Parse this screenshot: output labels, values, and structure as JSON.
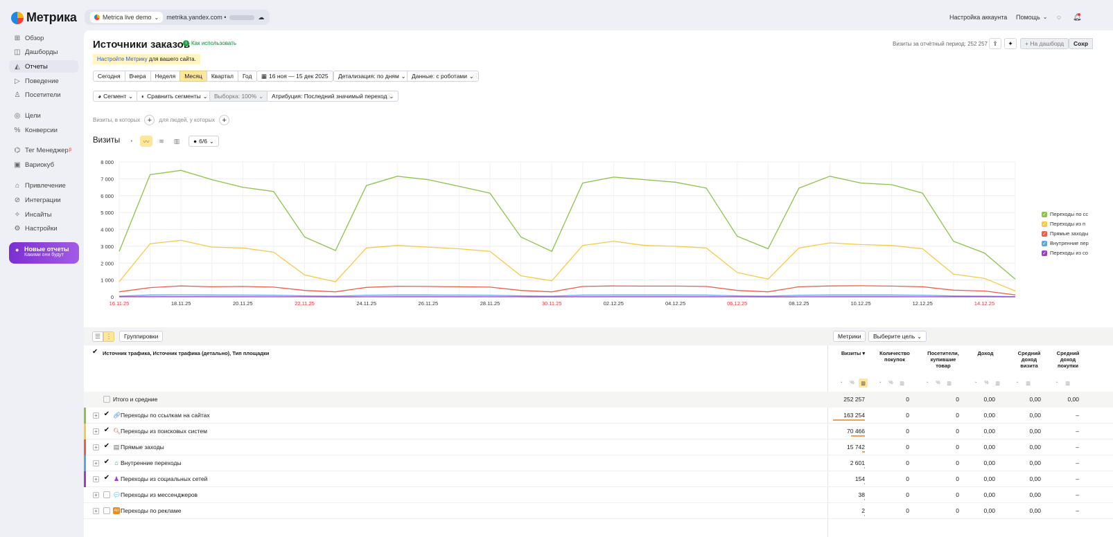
{
  "app": {
    "logo_text": "Метрика"
  },
  "counter": {
    "name": "Metrica live demo",
    "domain": "metrika.yandex.com •"
  },
  "topnav": {
    "account": "Настройка аккаунта",
    "help": "Помощь"
  },
  "sidebar": {
    "items": [
      {
        "label": "Обзор",
        "icon": "grid-icon"
      },
      {
        "label": "Дашборды",
        "icon": "dashboard-icon"
      },
      {
        "label": "Отчеты",
        "icon": "reports-icon"
      },
      {
        "label": "Поведение",
        "icon": "play-icon"
      },
      {
        "label": "Посетители",
        "icon": "user-icon"
      },
      {
        "label": "Цели",
        "icon": "target-icon"
      },
      {
        "label": "Конверсии",
        "icon": "percent-icon"
      },
      {
        "label": "Тег Менеджер",
        "icon": "tag-icon"
      },
      {
        "label": "Вариокуб",
        "icon": "cube-icon"
      },
      {
        "label": "Привлечение",
        "icon": "house-icon"
      },
      {
        "label": "Интеграции",
        "icon": "link-icon"
      },
      {
        "label": "Инсайты",
        "icon": "sparkle-icon"
      },
      {
        "label": "Настройки",
        "icon": "gear-icon"
      }
    ],
    "tag_badge": "β",
    "promo": {
      "title": "Новые отчеты",
      "subtitle": "Какими они будут"
    }
  },
  "page": {
    "title": "Источники заказов",
    "howto": "Как использовать",
    "banner_link": "Настройте Метрику",
    "banner_rest": " для вашего сайта.",
    "visits_period": "Визиты за отчётный период: 252 257",
    "dashboard_btn": "+ На дашборд",
    "save_btn": "Сохр"
  },
  "filters": {
    "periods": [
      "Сегодня",
      "Вчера",
      "Неделя",
      "Месяц",
      "Квартал",
      "Год"
    ],
    "active_period": "Месяц",
    "date_range": "16 ноя — 15 дек 2025",
    "detail": "Детализация: по дням",
    "data": "Данные: с роботами",
    "segment": "Сегмент",
    "compare": "Сравнить сегменты",
    "sample": "Выборка: 100%",
    "attribution": "Атрибуция: Последний значимый переход",
    "cond_left": "Визиты, в которых",
    "cond_right": "для людей, у которых"
  },
  "visits_block": {
    "title": "Визиты",
    "series_count": "6/6"
  },
  "chart_data": {
    "type": "line",
    "x": [
      "16.11.25",
      "17.11.25",
      "18.11.25",
      "19.11.25",
      "20.11.25",
      "21.11.25",
      "22.11.25",
      "23.11.25",
      "24.11.25",
      "25.11.25",
      "26.11.25",
      "27.11.25",
      "28.11.25",
      "29.11.25",
      "30.11.25",
      "01.12.25",
      "02.12.25",
      "03.12.25",
      "04.12.25",
      "05.12.25",
      "06.12.25",
      "07.12.25",
      "08.12.25",
      "09.12.25",
      "10.12.25",
      "11.12.25",
      "12.12.25",
      "13.12.25",
      "14.12.25",
      "15.12.25"
    ],
    "x_tick_labels": [
      "16.11.25",
      "18.11.25",
      "20.11.25",
      "22.11.25",
      "24.11.25",
      "26.11.25",
      "28.11.25",
      "30.11.25",
      "02.12.25",
      "04.12.25",
      "06.12.25",
      "08.12.25",
      "10.12.25",
      "12.12.25",
      "14.12.25"
    ],
    "weekend_ticks": [
      "16.11.25",
      "22.11.25",
      "30.11.25",
      "06.12.25",
      "14.12.25"
    ],
    "y_ticks": [
      "0",
      "1 000",
      "2 000",
      "3 000",
      "4 000",
      "5 000",
      "6 000",
      "7 000",
      "8 000"
    ],
    "ylim": [
      0,
      8000
    ],
    "grid": true,
    "legend_position": "right",
    "series": [
      {
        "name": "Переходы по сс",
        "color": "#8bc34a",
        "values": [
          2700,
          7250,
          7500,
          6950,
          6500,
          6250,
          3550,
          2750,
          6600,
          7150,
          6950,
          6550,
          6150,
          3550,
          2700,
          6750,
          7100,
          6950,
          6800,
          6450,
          3600,
          2850,
          6450,
          7150,
          6750,
          6650,
          6150,
          3300,
          2600,
          1050
        ]
      },
      {
        "name": "Переходы из п",
        "color": "#f8c945",
        "values": [
          900,
          3150,
          3350,
          2950,
          2900,
          2650,
          1300,
          900,
          2900,
          3050,
          2950,
          2850,
          2700,
          1250,
          950,
          3050,
          3300,
          3050,
          3000,
          2900,
          1450,
          1050,
          2900,
          3200,
          3100,
          3050,
          2850,
          1350,
          1100,
          350
        ]
      },
      {
        "name": "Прямые заходы",
        "color": "#f25c44",
        "values": [
          300,
          550,
          650,
          600,
          620,
          580,
          380,
          300,
          560,
          630,
          620,
          600,
          580,
          380,
          300,
          620,
          650,
          640,
          640,
          620,
          380,
          300,
          600,
          650,
          660,
          640,
          600,
          400,
          350,
          120
        ]
      },
      {
        "name": "Внутренние пер",
        "color": "#5aa7e0",
        "values": [
          40,
          110,
          120,
          110,
          105,
          100,
          60,
          40,
          100,
          110,
          110,
          105,
          100,
          60,
          40,
          105,
          110,
          110,
          110,
          105,
          60,
          40,
          100,
          110,
          110,
          110,
          100,
          55,
          45,
          15
        ]
      },
      {
        "name": "Переходы из со",
        "color": "#9c3fc4",
        "values": [
          5,
          8,
          8,
          7,
          7,
          6,
          3,
          2,
          6,
          7,
          7,
          7,
          6,
          3,
          2,
          7,
          8,
          7,
          7,
          7,
          3,
          2,
          6,
          8,
          7,
          7,
          6,
          3,
          3,
          1
        ]
      }
    ]
  },
  "table": {
    "groupings_btn": "Группировки",
    "metrics_btn": "Метрики",
    "goal_btn": "Выберите цель",
    "dimension_header": "Источник трафика, Источник трафика (детально), Тип площадки",
    "columns": [
      {
        "lines": [
          "Визиты ▾"
        ]
      },
      {
        "lines": [
          "Количество",
          "покупок"
        ]
      },
      {
        "lines": [
          "Посетители,",
          "купившие",
          "товар"
        ]
      },
      {
        "lines": [
          "Доход"
        ]
      },
      {
        "lines": [
          "Средний",
          "доход",
          "визита"
        ]
      },
      {
        "lines": [
          "Средний",
          "доход",
          "покупки"
        ]
      }
    ],
    "totals": {
      "label": "Итого и средние",
      "cells": [
        "252 257",
        "0",
        "0",
        "0,00",
        "0,00",
        "0,00"
      ]
    },
    "rows": [
      {
        "label": "Переходы по ссылкам на сайтах",
        "color": "#8bc34a",
        "icon": "link-icon",
        "checked": true,
        "cells": [
          "163 254",
          "0",
          "0",
          "0,00",
          "0,00",
          "–"
        ],
        "share": 0.647
      },
      {
        "label": "Переходы из поисковых систем",
        "color": "#f8c945",
        "icon": "search-icon",
        "checked": true,
        "cells": [
          "70 466",
          "0",
          "0",
          "0,00",
          "0,00",
          "–"
        ],
        "share": 0.279
      },
      {
        "label": "Прямые заходы",
        "color": "#f25c44",
        "icon": "browser-icon",
        "checked": true,
        "cells": [
          "15 742",
          "0",
          "0",
          "0,00",
          "0,00",
          "–"
        ],
        "share": 0.062
      },
      {
        "label": "Внутренние переходы",
        "color": "#5aa7e0",
        "icon": "home-icon",
        "checked": true,
        "cells": [
          "2 601",
          "0",
          "0",
          "0,00",
          "0,00",
          "–"
        ],
        "share": 0.01
      },
      {
        "label": "Переходы из социальных сетей",
        "color": "#9c3fc4",
        "icon": "person-icon",
        "checked": true,
        "cells": [
          "154",
          "0",
          "0",
          "0,00",
          "0,00",
          "–"
        ],
        "share": 0.0006
      },
      {
        "label": "Переходы из мессенджеров",
        "color": "",
        "icon": "chat-icon",
        "checked": false,
        "cells": [
          "38",
          "0",
          "0",
          "0,00",
          "0,00",
          "–"
        ],
        "share": 0.00015
      },
      {
        "label": "Переходы по рекламе",
        "color": "",
        "icon": "ad-icon",
        "checked": false,
        "cells": [
          "2",
          "0",
          "0",
          "0,00",
          "0,00",
          "–"
        ],
        "share": 1e-05
      }
    ]
  }
}
